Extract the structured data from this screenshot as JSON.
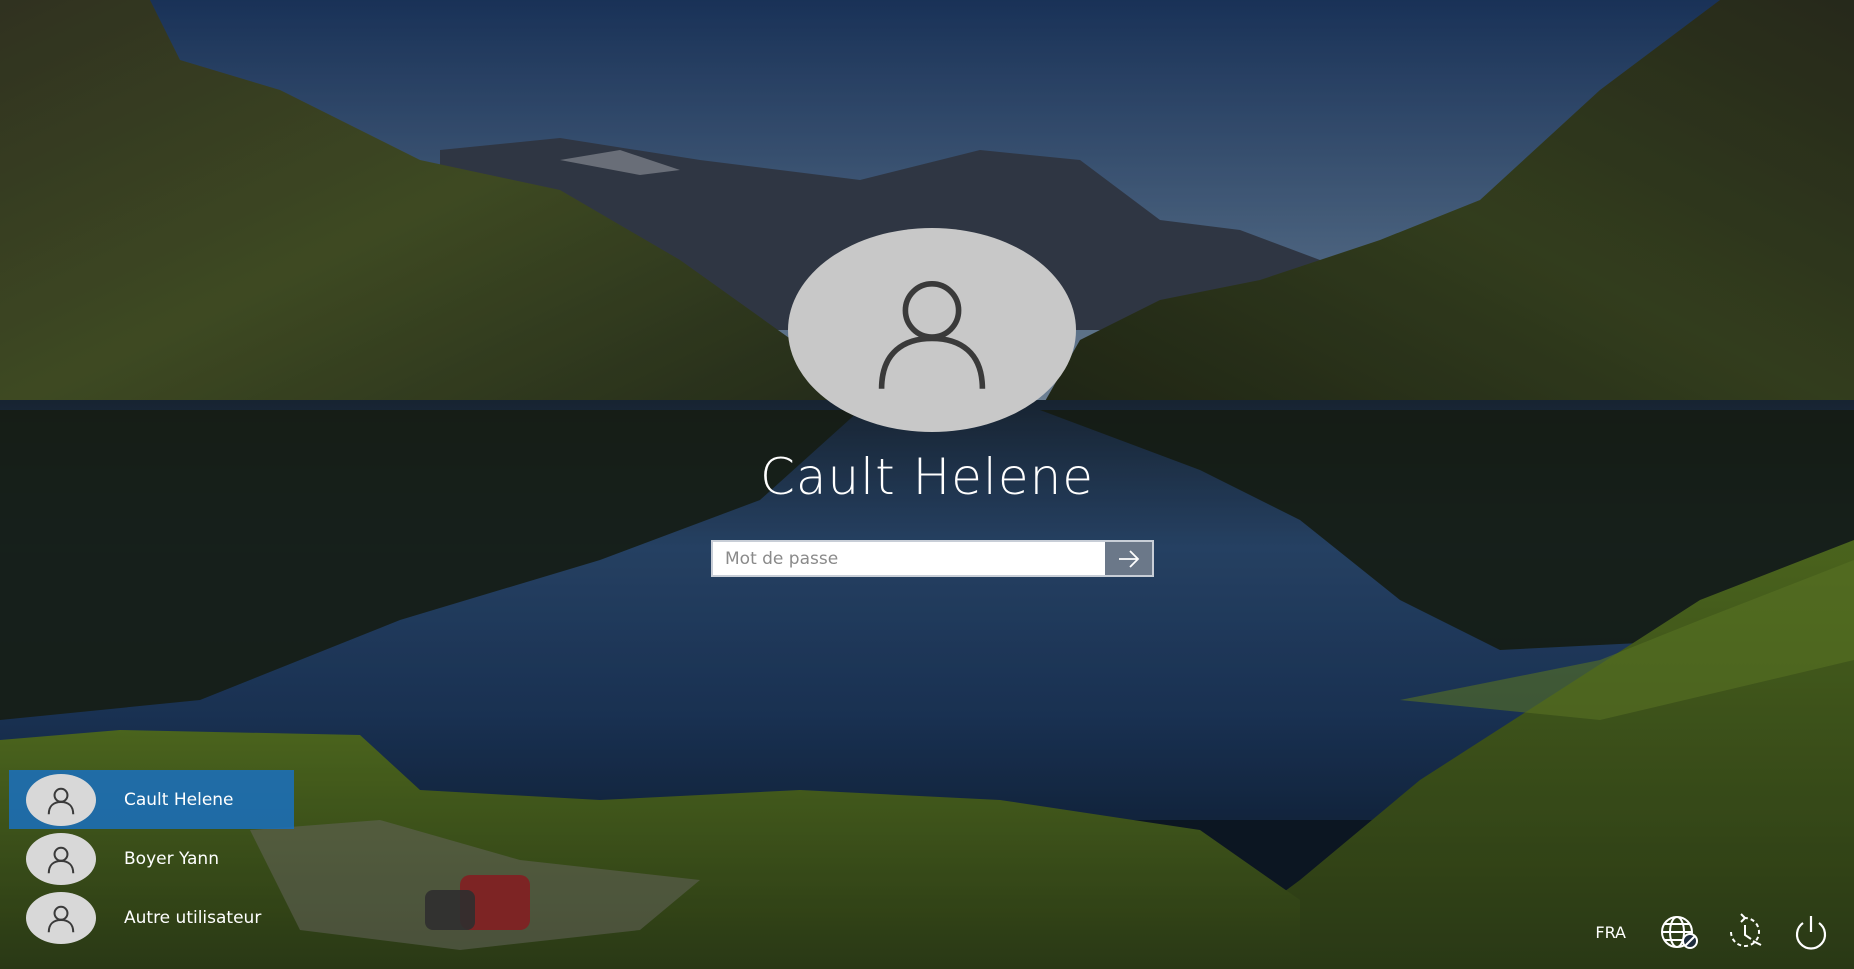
{
  "login": {
    "user_name": "Cault Helene",
    "password_placeholder": "Mot de passe",
    "password_value": ""
  },
  "users": [
    {
      "name": "Cault Helene",
      "selected": true
    },
    {
      "name": "Boyer Yann",
      "selected": false
    },
    {
      "name": "Autre utilisateur",
      "selected": false
    }
  ],
  "tray": {
    "language": "FRA",
    "icons": [
      "network-icon",
      "accessibility-icon",
      "power-icon"
    ]
  },
  "colors": {
    "selected_user_bg": "#1a70be",
    "avatar_bg": "#c8c8c8"
  }
}
